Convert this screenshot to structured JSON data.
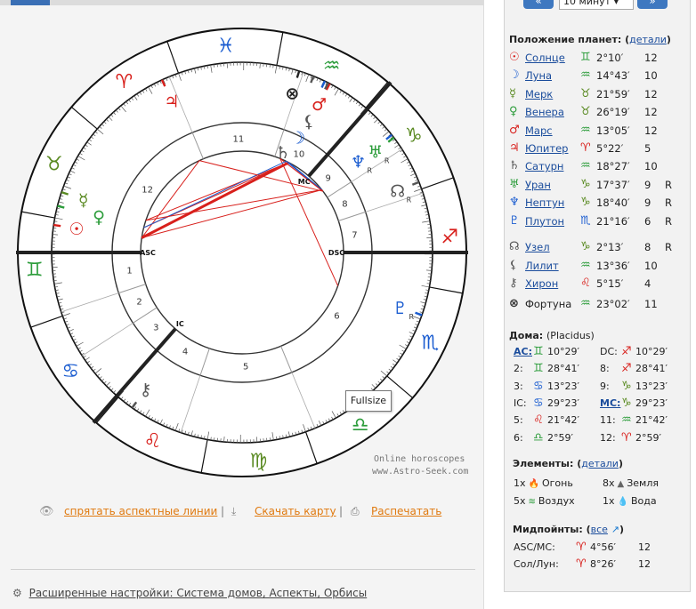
{
  "colors": {
    "fire": "#d8201c",
    "earth": "#5a8a22",
    "air": "#2b9c3a",
    "water": "#1a5cd0",
    "link": "#1a4c9c",
    "orange": "#e07a10"
  },
  "nav": {
    "prev": "«",
    "next": "»",
    "step": "10 минут"
  },
  "planets_section": {
    "title": "Положение планет:",
    "details": "детали"
  },
  "planets": [
    {
      "glyph": "☉",
      "name": "Солнце",
      "sign": "♊",
      "deg": "2°10′",
      "house": "12",
      "retro": "",
      "color": "#d8201c",
      "scolor": "#2b9c3a"
    },
    {
      "glyph": "☽",
      "name": "Луна",
      "sign": "♒",
      "deg": "14°43′",
      "house": "10",
      "retro": "",
      "color": "#1a5cd0",
      "scolor": "#2b9c3a"
    },
    {
      "glyph": "☿",
      "name": "Мерк",
      "sign": "♉",
      "deg": "21°59′",
      "house": "12",
      "retro": "",
      "color": "#5a8a22",
      "scolor": "#5a8a22"
    },
    {
      "glyph": "♀",
      "name": "Венера",
      "sign": "♉",
      "deg": "26°19′",
      "house": "12",
      "retro": "",
      "color": "#2b9c3a",
      "scolor": "#5a8a22"
    },
    {
      "glyph": "♂",
      "name": "Марс",
      "sign": "♒",
      "deg": "13°05′",
      "house": "12",
      "retro": "",
      "color": "#d8201c",
      "scolor": "#2b9c3a"
    },
    {
      "glyph": "♃",
      "name": "Юпитер",
      "sign": "♈",
      "deg": "5°22′",
      "house": "5",
      "retro": "",
      "color": "#d8201c",
      "scolor": "#d8201c"
    },
    {
      "glyph": "♄",
      "name": "Сатурн",
      "sign": "♒",
      "deg": "18°27′",
      "house": "10",
      "retro": "",
      "color": "#555555",
      "scolor": "#2b9c3a"
    },
    {
      "glyph": "♅",
      "name": "Уран",
      "sign": "♑",
      "deg": "17°37′",
      "house": "9",
      "retro": "R",
      "color": "#2b9c3a",
      "scolor": "#5a8a22"
    },
    {
      "glyph": "♆",
      "name": "Нептун",
      "sign": "♑",
      "deg": "18°40′",
      "house": "9",
      "retro": "R",
      "color": "#1a5cd0",
      "scolor": "#5a8a22"
    },
    {
      "glyph": "♇",
      "name": "Плутон",
      "sign": "♏",
      "deg": "21°16′",
      "house": "6",
      "retro": "R",
      "color": "#1a5cd0",
      "scolor": "#1a5cd0"
    }
  ],
  "points": [
    {
      "glyph": "☊",
      "name": "Узел",
      "sign": "♑",
      "deg": "2°13′",
      "house": "8",
      "retro": "R",
      "color": "#555555",
      "scolor": "#5a8a22"
    },
    {
      "glyph": "⚸",
      "name": "Лилит",
      "sign": "♒",
      "deg": "13°36′",
      "house": "10",
      "retro": "",
      "color": "#555555",
      "scolor": "#2b9c3a"
    },
    {
      "glyph": "⚷",
      "name": "Хирон",
      "sign": "♌",
      "deg": "5°15′",
      "house": "4",
      "retro": "",
      "color": "#555555",
      "scolor": "#d8201c"
    }
  ],
  "fortune": {
    "glyph": "⊗",
    "name": "Фортуна",
    "sign": "♒",
    "deg": "23°02′",
    "house": "11",
    "scolor": "#2b9c3a"
  },
  "houses_section": {
    "title": "Дома:",
    "system": "(Placidus)"
  },
  "houses": [
    {
      "label": "AC:",
      "sign": "♊",
      "deg": "10°29′",
      "scolor": "#2b9c3a",
      "underline": true
    },
    {
      "label": "DC:",
      "sign": "♐",
      "deg": "10°29′",
      "scolor": "#d8201c",
      "underline": false
    },
    {
      "label": "2:",
      "sign": "♊",
      "deg": "28°41′",
      "scolor": "#2b9c3a",
      "underline": false
    },
    {
      "label": "8:",
      "sign": "♐",
      "deg": "28°41′",
      "scolor": "#d8201c",
      "underline": false
    },
    {
      "label": "3:",
      "sign": "♋",
      "deg": "13°23′",
      "scolor": "#1a5cd0",
      "underline": false
    },
    {
      "label": "9:",
      "sign": "♑",
      "deg": "13°23′",
      "scolor": "#5a8a22",
      "underline": false
    },
    {
      "label": "IC:",
      "sign": "♋",
      "deg": "29°23′",
      "scolor": "#1a5cd0",
      "underline": false
    },
    {
      "label": "MC:",
      "sign": "♑",
      "deg": "29°23′",
      "scolor": "#5a8a22",
      "underline": true
    },
    {
      "label": "5:",
      "sign": "♌",
      "deg": "21°42′",
      "scolor": "#d8201c",
      "underline": false
    },
    {
      "label": "11:",
      "sign": "♒",
      "deg": "21°42′",
      "scolor": "#2b9c3a",
      "underline": false
    },
    {
      "label": "6:",
      "sign": "♎",
      "deg": "2°59′",
      "scolor": "#2b9c3a",
      "underline": false
    },
    {
      "label": "12:",
      "sign": "♈",
      "deg": "2°59′",
      "scolor": "#d8201c",
      "underline": false
    }
  ],
  "elements_section": {
    "title": "Элементы:",
    "details": "детали"
  },
  "elements": [
    {
      "count": "1x",
      "icon": "🔥",
      "name": "Огонь",
      "color": "#e05a10"
    },
    {
      "count": "8x",
      "icon": "▲",
      "name": "Земля",
      "color": "#666666"
    },
    {
      "count": "5x",
      "icon": "≋",
      "name": "Воздух",
      "color": "#2b9c3a"
    },
    {
      "count": "1x",
      "icon": "💧",
      "name": "Вода",
      "color": "#1a7ad0"
    }
  ],
  "midpoints_section": {
    "title": "Мидпойнты:",
    "all": "все"
  },
  "midpoints": [
    {
      "name": "ASC/MC:",
      "sign": "♈",
      "deg": "4°56′",
      "house": "12",
      "scolor": "#d8201c"
    },
    {
      "name": "Сол/Лун:",
      "sign": "♈",
      "deg": "8°26′",
      "house": "12",
      "scolor": "#d8201c"
    }
  ],
  "links": {
    "hide": "спрятать аспектные линии",
    "download": "Скачать карту",
    "print": "Распечатать",
    "sep": "|"
  },
  "advanced": "Расширенные настройки: Система домов, Аспекты, Орбисы",
  "watermark": {
    "l1": "Online horoscopes",
    "l2": "www.Astro-Seek.com"
  },
  "fullsize": "Fullsize",
  "chart_labels": {
    "asc": "ASC",
    "dsc": "DSC",
    "mc": "MC",
    "ic": "IC",
    "retro": "R"
  }
}
